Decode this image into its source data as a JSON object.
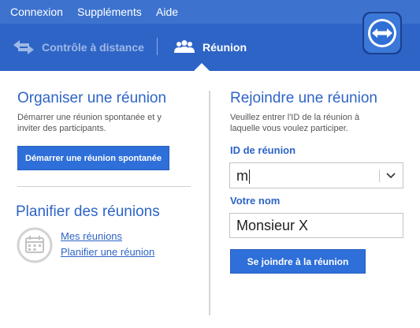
{
  "menu": {
    "items": [
      "Connexion",
      "Suppléments",
      "Aide"
    ]
  },
  "nav": {
    "remote_control_label": "Contrôle à distance",
    "meeting_label": "Réunion"
  },
  "left": {
    "organize": {
      "title": "Organiser une réunion",
      "description_line1": "Démarrer une réunion spontanée et y",
      "description_line2": "inviter des participants.",
      "start_button_label": "Démarrer une réunion spontanée"
    },
    "plan": {
      "title": "Planifier des réunions",
      "my_meetings_link": "Mes réunions",
      "plan_meeting_link": "Planifier une réunion"
    }
  },
  "right": {
    "join": {
      "title": "Rejoindre une réunion",
      "description_line1": "Veuillez entrer l'ID de la réunion à",
      "description_line2": "laquelle vous voulez participer.",
      "meeting_id_label": "ID de réunion",
      "meeting_id_value": "m",
      "name_label": "Votre nom",
      "name_value": "Monsieur X",
      "join_button_label": "Se joindre à la réunion"
    }
  },
  "colors": {
    "brand_blue": "#2e64c6",
    "menu_blue": "#3d73cf",
    "button_blue": "#2e6fd9"
  }
}
